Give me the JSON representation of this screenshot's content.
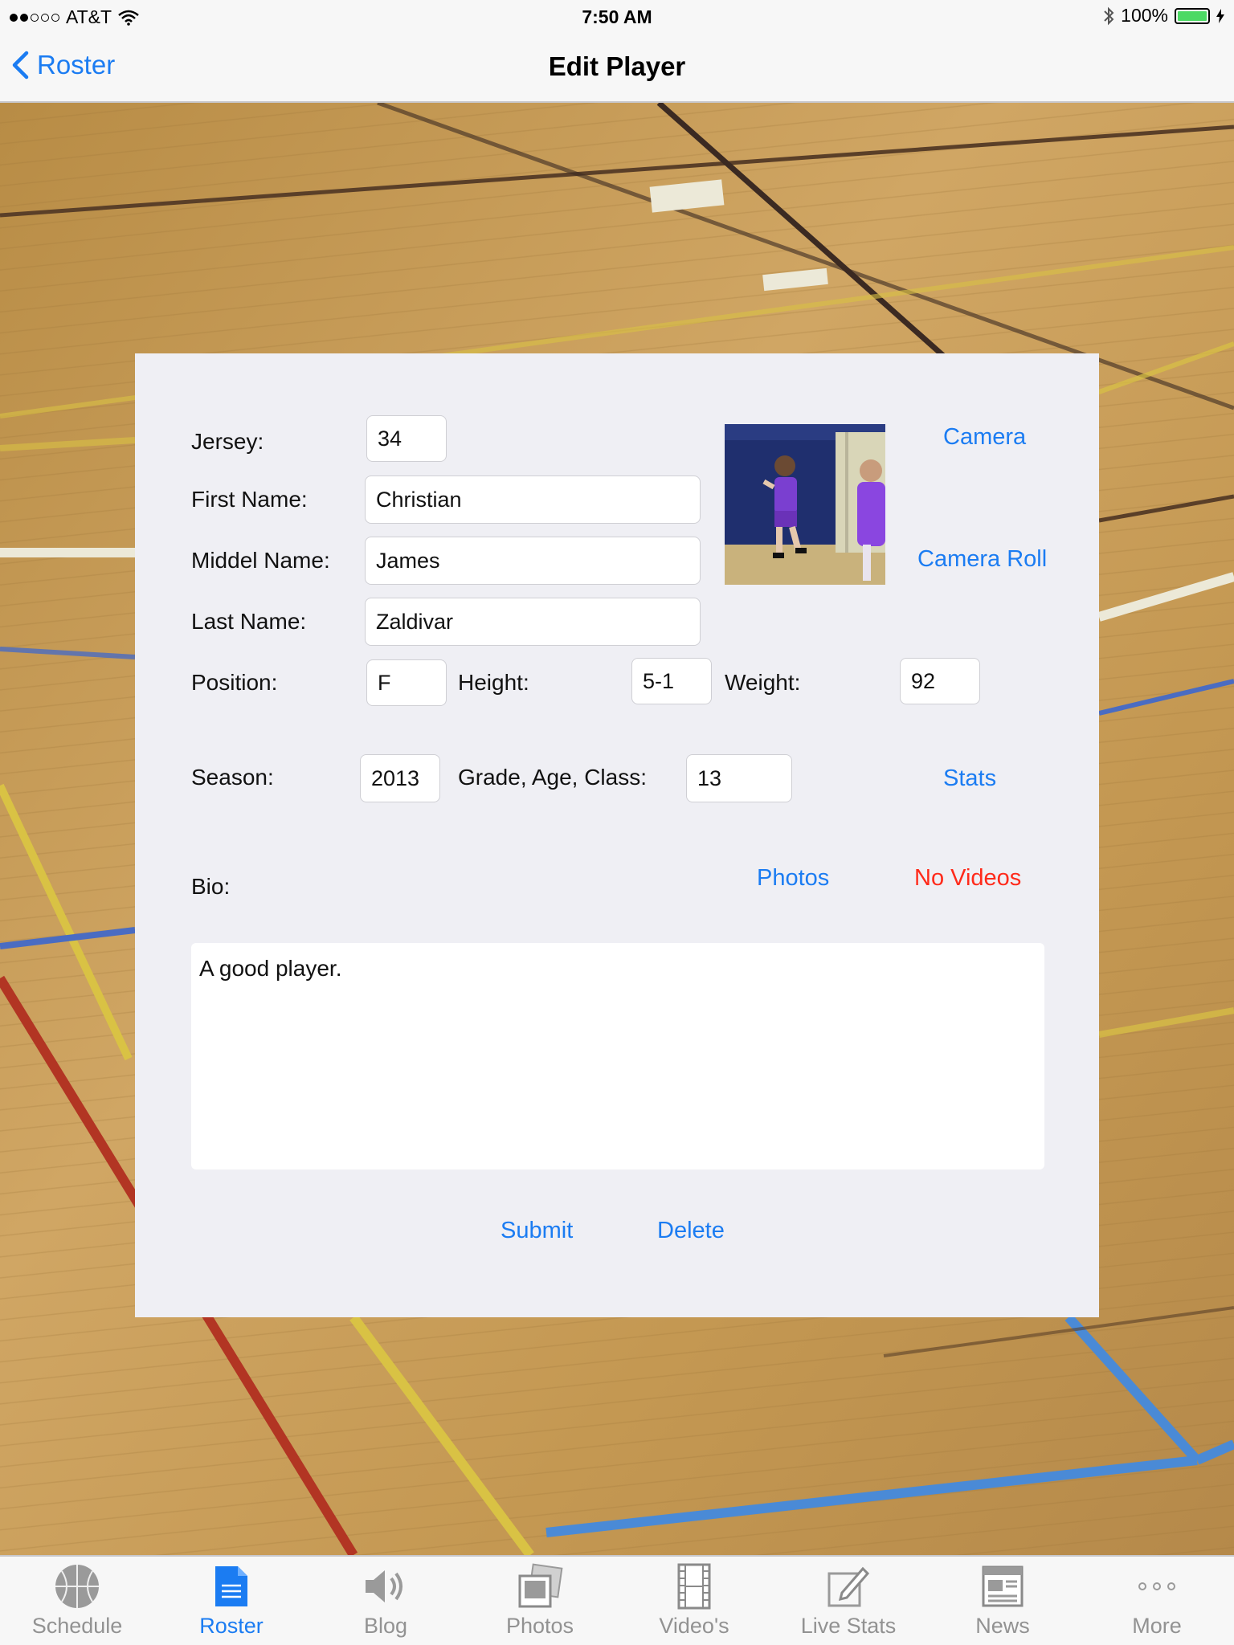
{
  "status": {
    "carrier": "AT&T",
    "time": "7:50 AM",
    "battery": "100%"
  },
  "nav": {
    "back_label": "Roster",
    "title": "Edit Player"
  },
  "form": {
    "jersey_label": "Jersey:",
    "jersey": "34",
    "first_label": "First Name:",
    "first": "Christian",
    "middle_label": "Middel Name:",
    "middle": "James",
    "last_label": "Last Name:",
    "last": "Zaldivar",
    "position_label": "Position:",
    "position": "F",
    "height_label": "Height:",
    "height": "5-1",
    "weight_label": "Weight:",
    "weight": "92",
    "season_label": "Season:",
    "season": "2013",
    "grade_label": "Grade, Age, Class:",
    "grade": "13",
    "bio_label": "Bio:",
    "bio": "A good player."
  },
  "links": {
    "camera": "Camera",
    "camera_roll": "Camera Roll",
    "stats": "Stats",
    "photos": "Photos",
    "no_videos": "No Videos",
    "submit": "Submit",
    "delete": "Delete"
  },
  "tabs": [
    {
      "label": "Schedule",
      "icon": "basketball-icon"
    },
    {
      "label": "Roster",
      "icon": "document-icon"
    },
    {
      "label": "Blog",
      "icon": "speaker-icon"
    },
    {
      "label": "Photos",
      "icon": "photos-icon"
    },
    {
      "label": "Video's",
      "icon": "film-icon"
    },
    {
      "label": "Live Stats",
      "icon": "compose-icon"
    },
    {
      "label": "News",
      "icon": "newspaper-icon"
    },
    {
      "label": "More",
      "icon": "more-icon"
    }
  ],
  "colors": {
    "accent": "#1b7cf2",
    "warning": "#ff2a1a",
    "court": "#c39a52"
  }
}
